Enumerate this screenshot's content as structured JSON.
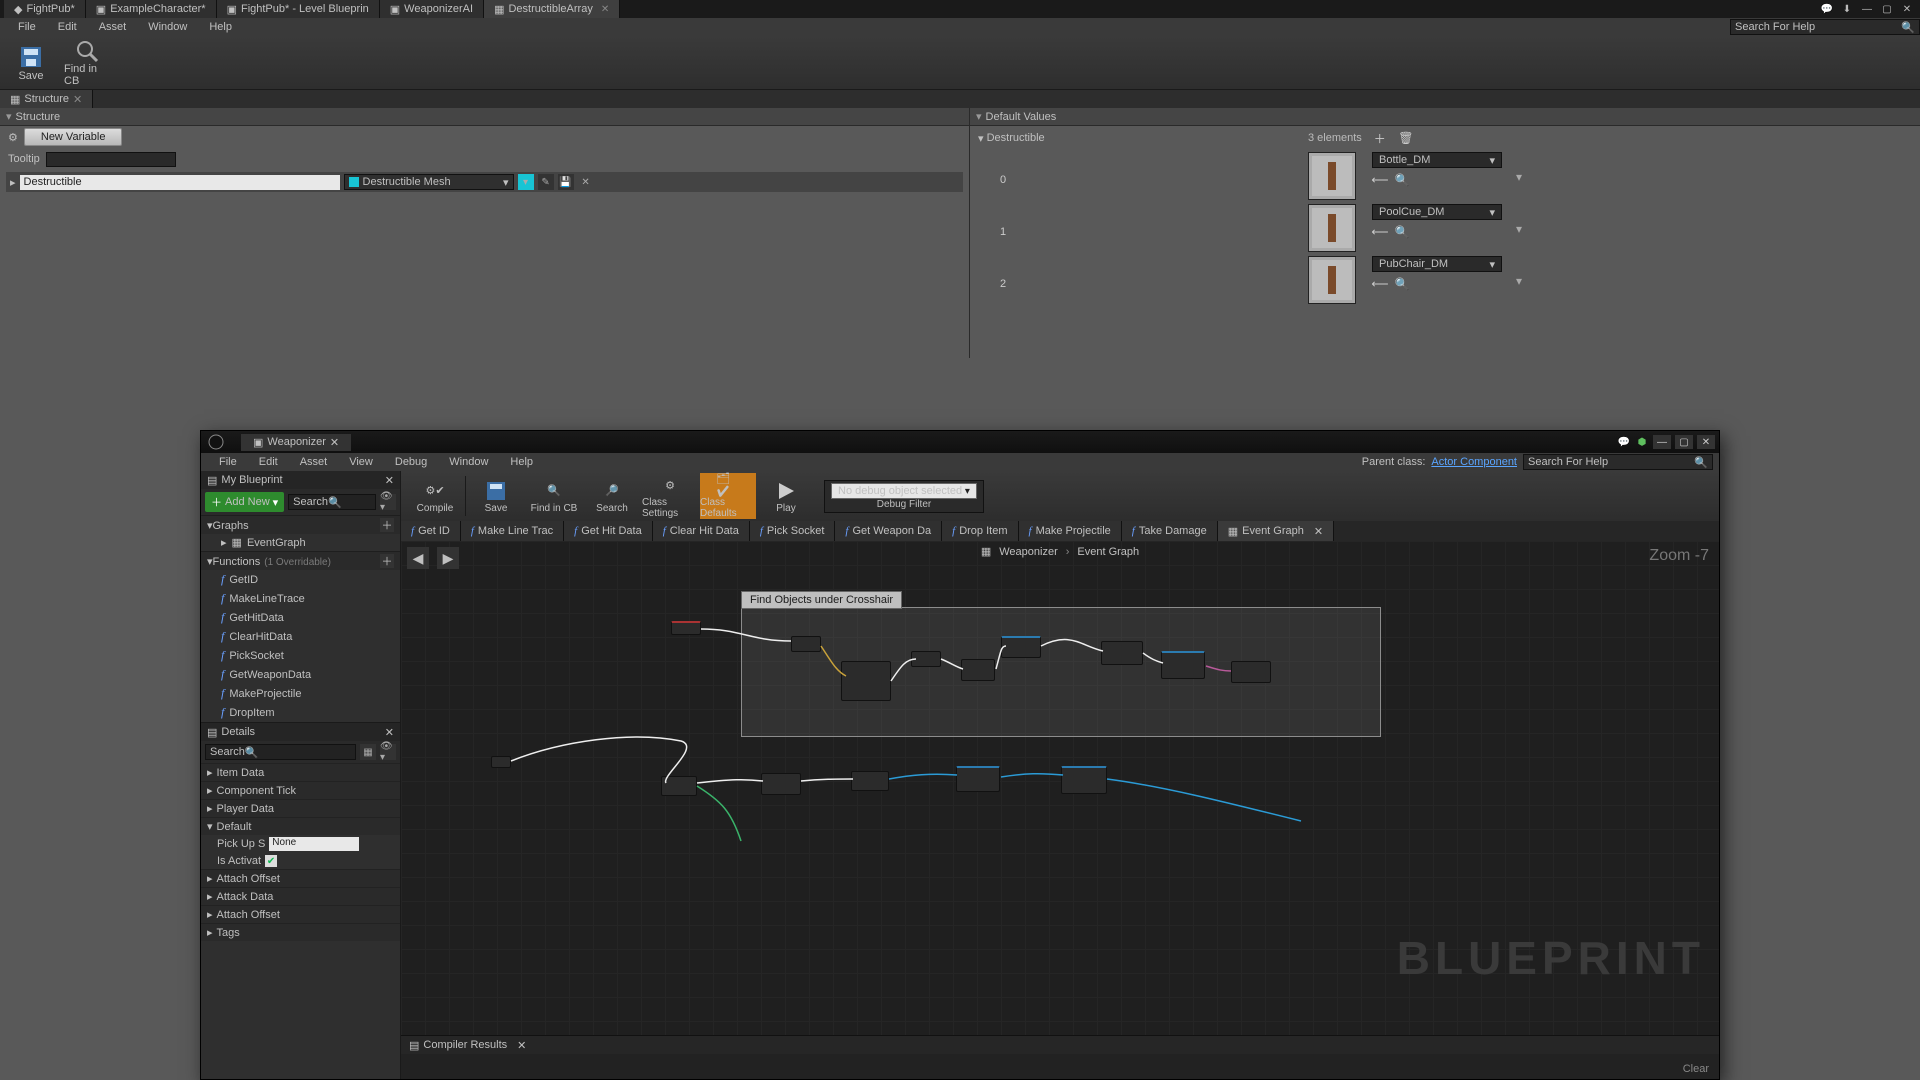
{
  "top_tabs": [
    {
      "icon": "ue",
      "label": "FightPub*"
    },
    {
      "icon": "bp",
      "label": "ExampleCharacter*"
    },
    {
      "icon": "bp",
      "label": "FightPub* - Level Blueprin"
    },
    {
      "icon": "bp",
      "label": "WeaponizerAI"
    },
    {
      "icon": "struct",
      "label": "DestructibleArray",
      "active": true
    }
  ],
  "menubar": [
    "File",
    "Edit",
    "Asset",
    "Window",
    "Help"
  ],
  "search_help_placeholder": "Search For Help",
  "toolbar": {
    "save": "Save",
    "find": "Find in CB"
  },
  "doc_tab": "Structure",
  "structure": {
    "header": "Structure",
    "new_variable": "New Variable",
    "tooltip_label": "Tooltip",
    "variable_name": "Destructible",
    "type_label": "Destructible Mesh"
  },
  "default_values": {
    "header": "Default Values",
    "section": "Destructible",
    "count_label": "3 elements",
    "items": [
      {
        "index": "0",
        "ref": "Bottle_DM"
      },
      {
        "index": "1",
        "ref": "PoolCue_DM"
      },
      {
        "index": "2",
        "ref": "PubChair_DM"
      }
    ]
  },
  "bp": {
    "tab": "Weaponizer",
    "menubar": [
      "File",
      "Edit",
      "Asset",
      "View",
      "Debug",
      "Window",
      "Help"
    ],
    "parent_label": "Parent class:",
    "parent_class": "Actor Component",
    "my_blueprint_tab": "My Blueprint",
    "add_new": "Add New",
    "left_search_placeholder": "Search",
    "graphs_header": "Graphs",
    "event_graph": "EventGraph",
    "functions_header": "Functions",
    "functions_note": "(1 Overridable)",
    "functions": [
      "GetID",
      "MakeLineTrace",
      "GetHitData",
      "ClearHitData",
      "PickSocket",
      "GetWeaponData",
      "MakeProjectile",
      "DropItem"
    ],
    "details_tab": "Details",
    "details_search_placeholder": "Search",
    "cats": {
      "item_data": "Item Data",
      "component_tick": "Component Tick",
      "player_data": "Player Data",
      "default": "Default",
      "attach_offset": "Attach Offset",
      "attack_data": "Attack Data",
      "attach_offset2": "Attach Offset",
      "tags": "Tags"
    },
    "props": {
      "pickup_label": "Pick Up S",
      "pickup_value": "None",
      "is_activated_label": "Is Activat"
    },
    "toolbar": {
      "compile": "Compile",
      "save": "Save",
      "find": "Find in CB",
      "search": "Search",
      "class_settings": "Class Settings",
      "class_defaults": "Class Defaults",
      "play": "Play",
      "debug_dd": "No debug object selected",
      "debug_filter": "Debug Filter"
    },
    "tabs": [
      "Get ID",
      "Make Line Trac",
      "Get Hit Data",
      "Clear Hit Data",
      "Pick Socket",
      "Get Weapon Da",
      "Drop Item",
      "Make Projectile",
      "Take Damage"
    ],
    "tab_eventgraph": "Event Graph",
    "breadcrumb": {
      "root": "Weaponizer",
      "leaf": "Event Graph"
    },
    "zoom": "Zoom  -7",
    "watermark": "BLUEPRINT",
    "comment": "Find Objects under Crosshair",
    "compiler_tab": "Compiler Results",
    "clear": "Clear"
  }
}
